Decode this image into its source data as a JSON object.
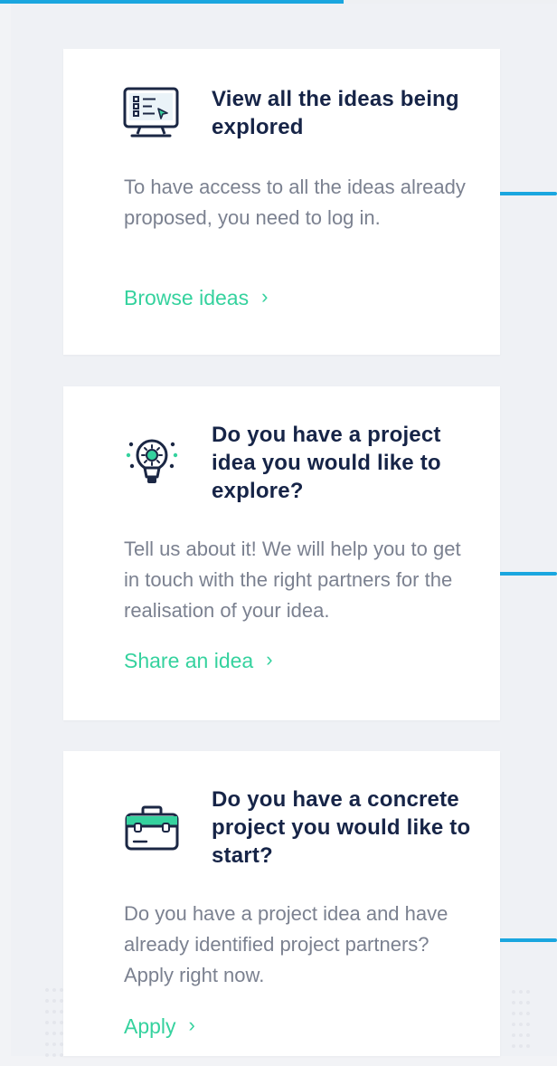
{
  "cards": [
    {
      "icon": "monitor-list-icon",
      "title": "View all the ideas being explored",
      "description": "To have access to all the ideas already proposed, you need to log in.",
      "link_label": "Browse ideas",
      "chevron": "›"
    },
    {
      "icon": "lightbulb-gear-icon",
      "title": "Do you have a project idea you would like to explore?",
      "description": "Tell us about it! We will help you to get in touch with the right partners for the realisation of your idea.",
      "link_label": "Share an idea",
      "chevron": "›"
    },
    {
      "icon": "briefcase-icon",
      "title": "Do you have a concrete project you would like to start?",
      "description": "Do you have a project idea and have already identified project partners? Apply right now.",
      "link_label": "Apply",
      "chevron": "›"
    }
  ],
  "colors": {
    "background": "#eff1f5",
    "card_bg": "#ffffff",
    "title": "#162447",
    "body_text": "#7b8190",
    "link": "#35d29e",
    "accent_blue": "#1aa6df"
  }
}
